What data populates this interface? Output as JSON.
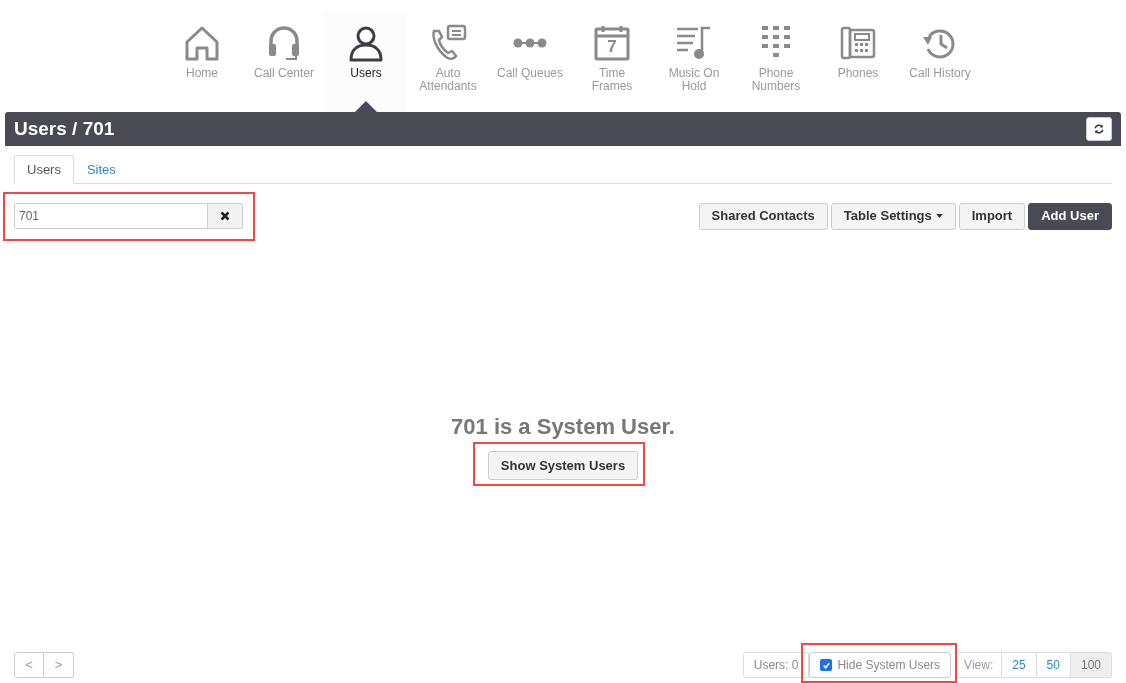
{
  "nav": [
    {
      "label": "Home",
      "kind": "home",
      "selected": false
    },
    {
      "label": "Call Center",
      "kind": "headset",
      "selected": false
    },
    {
      "label": "Users",
      "kind": "user",
      "selected": true
    },
    {
      "label": "Auto Attendants",
      "kind": "attendant",
      "selected": false
    },
    {
      "label": "Call Queues",
      "kind": "queue",
      "selected": false
    },
    {
      "label": "Time Frames",
      "kind": "calendar",
      "selected": false,
      "icon_text": "7"
    },
    {
      "label": "Music On Hold",
      "kind": "music",
      "selected": false
    },
    {
      "label": "Phone Numbers",
      "kind": "keypad",
      "selected": false
    },
    {
      "label": "Phones",
      "kind": "deskphone",
      "selected": false
    },
    {
      "label": "Call History",
      "kind": "history",
      "selected": false
    }
  ],
  "header": {
    "title": "Users",
    "separator": "/",
    "crumb": "701"
  },
  "tabs": [
    {
      "label": "Users",
      "selected": true
    },
    {
      "label": "Sites",
      "selected": false
    }
  ],
  "search": {
    "value": "701",
    "highlighted": true
  },
  "actions": [
    {
      "label": "Shared Contacts",
      "kind": "plain"
    },
    {
      "label": "Table Settings",
      "kind": "dropdown"
    },
    {
      "label": "Import",
      "kind": "plain"
    },
    {
      "label": "Add User",
      "kind": "primary"
    }
  ],
  "message": {
    "text": "701 is a System User.",
    "button": "Show System Users",
    "highlighted": true
  },
  "footer": {
    "prev": "<",
    "next": ">",
    "count": "Users: 0",
    "hide_system": {
      "label": "Hide System Users",
      "checked": true,
      "highlighted": true
    },
    "view_label": "View:",
    "page_sizes": [
      {
        "label": "25",
        "selected": false
      },
      {
        "label": "50",
        "selected": false
      },
      {
        "label": "100",
        "selected": true
      }
    ]
  }
}
